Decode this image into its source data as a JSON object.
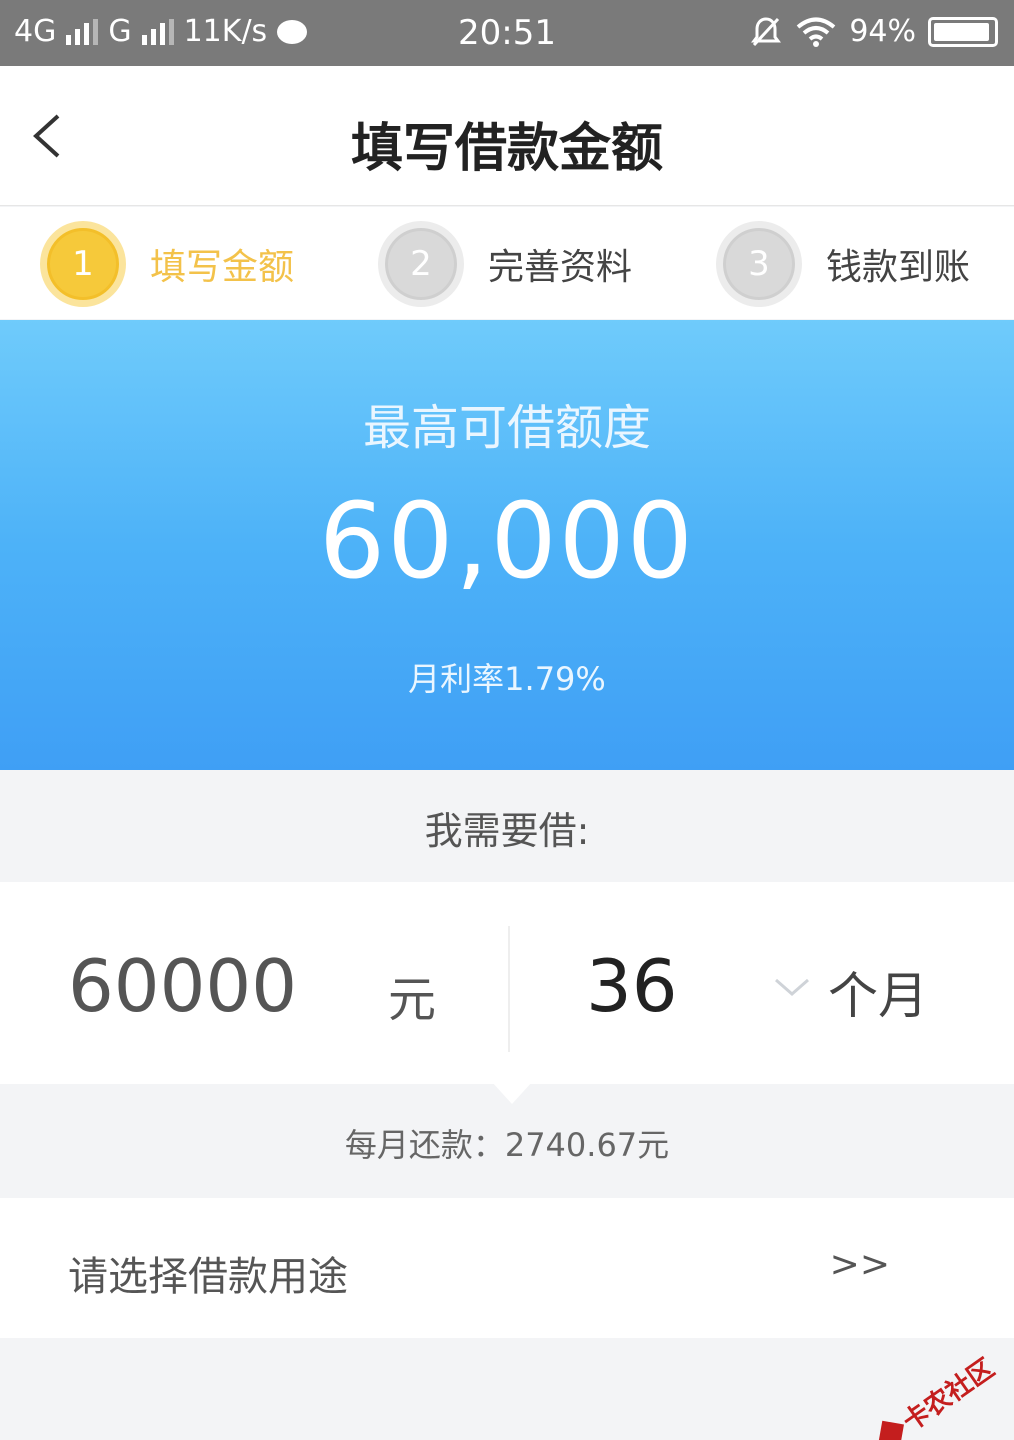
{
  "status_bar": {
    "network1": "4G",
    "network2": "G",
    "speed": "11K/s",
    "time": "20:51",
    "battery": "94%"
  },
  "header": {
    "title": "填写借款金额"
  },
  "steps": [
    {
      "number": "1",
      "label": "填写金额",
      "active": true
    },
    {
      "number": "2",
      "label": "完善资料",
      "active": false
    },
    {
      "number": "3",
      "label": "钱款到账",
      "active": false
    }
  ],
  "banner": {
    "title": "最高可借额度",
    "amount": "60,000",
    "rate": "月利率1.79%"
  },
  "form": {
    "need_label": "我需要借:",
    "amount_value": "60000",
    "amount_unit": "元",
    "term_value": "36",
    "term_unit": "个月",
    "monthly_payment": "每月还款：2740.67元",
    "purpose_label": "请选择借款用途",
    "purpose_arrow": ">>"
  },
  "watermark": {
    "text": "卡农社区"
  },
  "colors": {
    "accent_yellow": "#f3c24a",
    "banner_blue": "#4db2f8"
  }
}
